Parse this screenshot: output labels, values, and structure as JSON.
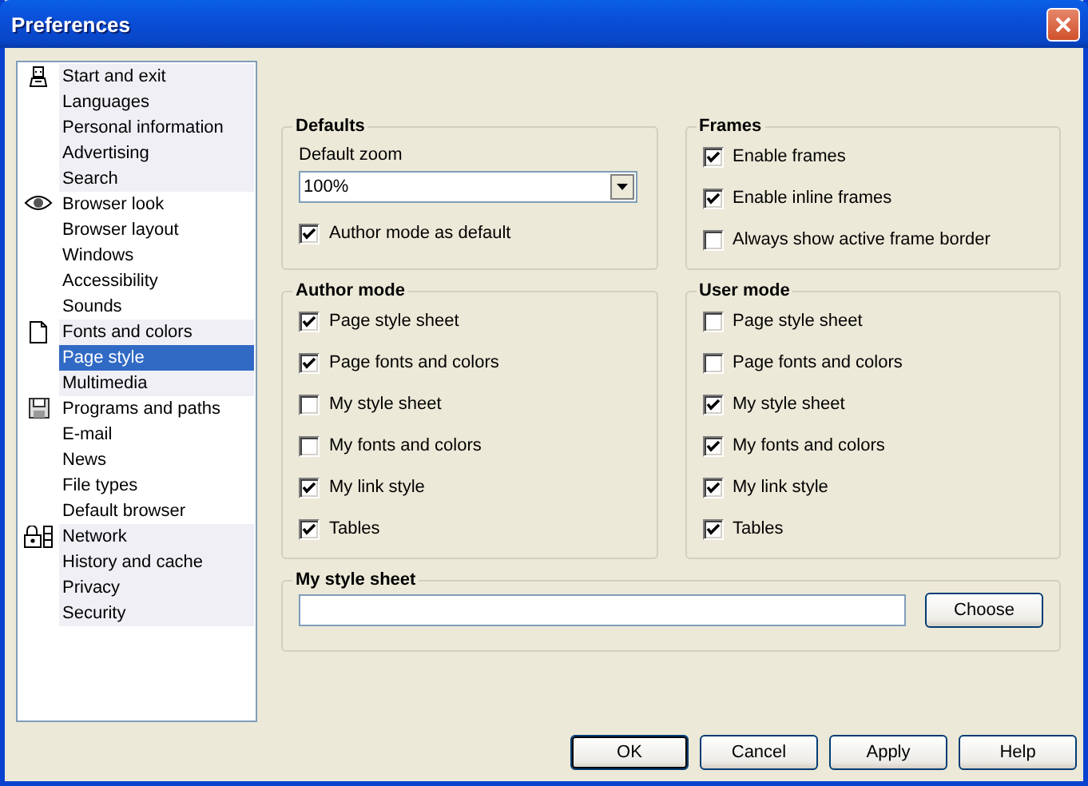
{
  "window": {
    "title": "Preferences"
  },
  "sidebar": {
    "groups": [
      {
        "kind": "person",
        "items": [
          {
            "label": "Start and exit",
            "selected": false
          },
          {
            "label": "Languages",
            "selected": false
          },
          {
            "label": "Personal information",
            "selected": false
          },
          {
            "label": "Advertising",
            "selected": false
          },
          {
            "label": "Search",
            "selected": false
          }
        ]
      },
      {
        "kind": "eye",
        "items": [
          {
            "label": "Browser look",
            "selected": false
          },
          {
            "label": "Browser layout",
            "selected": false
          },
          {
            "label": "Windows",
            "selected": false
          },
          {
            "label": "Accessibility",
            "selected": false
          },
          {
            "label": "Sounds",
            "selected": false
          }
        ]
      },
      {
        "kind": "page",
        "items": [
          {
            "label": "Fonts and colors",
            "selected": false
          },
          {
            "label": "Page style",
            "selected": true
          },
          {
            "label": "Multimedia",
            "selected": false
          }
        ]
      },
      {
        "kind": "disk",
        "items": [
          {
            "label": "Programs and paths",
            "selected": false
          },
          {
            "label": "E-mail",
            "selected": false
          },
          {
            "label": "News",
            "selected": false
          },
          {
            "label": "File types",
            "selected": false
          },
          {
            "label": "Default browser",
            "selected": false
          }
        ]
      },
      {
        "kind": "lock",
        "items": [
          {
            "label": "Network",
            "selected": false
          },
          {
            "label": "History and cache",
            "selected": false
          },
          {
            "label": "Privacy",
            "selected": false
          },
          {
            "label": "Security",
            "selected": false
          }
        ]
      }
    ]
  },
  "defaults": {
    "title": "Defaults",
    "zoom_label": "Default zoom",
    "zoom_value": "100%",
    "options": [
      {
        "label": "Author mode as default",
        "checked": true
      }
    ]
  },
  "frames": {
    "title": "Frames",
    "options": [
      {
        "label": "Enable frames",
        "checked": true
      },
      {
        "label": "Enable inline frames",
        "checked": true
      },
      {
        "label": "Always show active frame border",
        "checked": false
      }
    ]
  },
  "author_mode": {
    "title": "Author mode",
    "options": [
      {
        "label": "Page style sheet",
        "checked": true
      },
      {
        "label": "Page fonts and colors",
        "checked": true
      },
      {
        "label": "My style sheet",
        "checked": false
      },
      {
        "label": "My fonts and colors",
        "checked": false
      },
      {
        "label": "My link style",
        "checked": true
      },
      {
        "label": "Tables",
        "checked": true
      }
    ]
  },
  "user_mode": {
    "title": "User mode",
    "options": [
      {
        "label": "Page style sheet",
        "checked": false
      },
      {
        "label": "Page fonts and colors",
        "checked": false
      },
      {
        "label": "My style sheet",
        "checked": true
      },
      {
        "label": "My fonts and colors",
        "checked": true
      },
      {
        "label": "My link style",
        "checked": true
      },
      {
        "label": "Tables",
        "checked": true
      }
    ]
  },
  "style_sheet": {
    "title": "My style sheet",
    "button": "Choose"
  },
  "buttons": [
    {
      "label": "OK",
      "default": true
    },
    {
      "label": "Cancel",
      "default": false
    },
    {
      "label": "Apply",
      "default": false
    },
    {
      "label": "Help",
      "default": false
    }
  ]
}
